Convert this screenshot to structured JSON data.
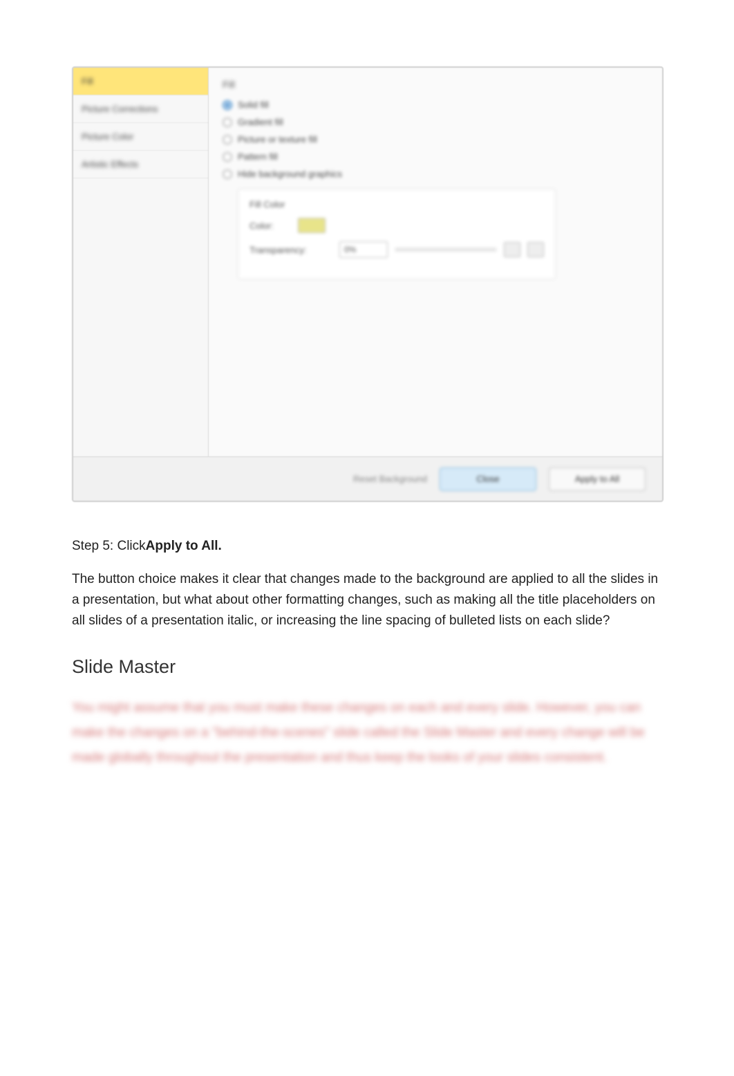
{
  "dialog": {
    "sidebar": {
      "tabs": [
        {
          "label": "Fill"
        },
        {
          "label": "Picture Corrections"
        },
        {
          "label": "Picture Color"
        },
        {
          "label": "Artistic Effects"
        }
      ]
    },
    "pane": {
      "title": "Fill",
      "radios": [
        {
          "label": "Solid fill",
          "checked": true
        },
        {
          "label": "Gradient fill",
          "checked": false
        },
        {
          "label": "Picture or texture fill",
          "checked": false
        },
        {
          "label": "Pattern fill",
          "checked": false
        },
        {
          "label": "Hide background graphics",
          "checked": false
        }
      ],
      "settings": {
        "fill_color_label": "Fill Color",
        "color_label": "Color:",
        "transparency_label": "Transparency:",
        "transparency_value": "0%"
      }
    },
    "footer": {
      "reset_label": "Reset Background",
      "close_label": "Close",
      "apply_all_label": "Apply to All"
    }
  },
  "step": {
    "prefix": "Step  5:  Click",
    "bold": "Apply to All."
  },
  "para1": "The button choice makes it clear that changes made to the background are applied to all the slides in a presentation, but what about other formatting changes, such as making all the title placeholders on all slides of a presentation italic, or increasing the line spacing of bulleted lists on each slide?",
  "heading": "Slide Master",
  "blurred": "You might assume that you must make these changes on each and every slide. However, you can make the changes on a \"behind-the-scenes\" slide called the Slide Master and every change will be made globally throughout the presentation and thus keep the looks of your slides consistent."
}
